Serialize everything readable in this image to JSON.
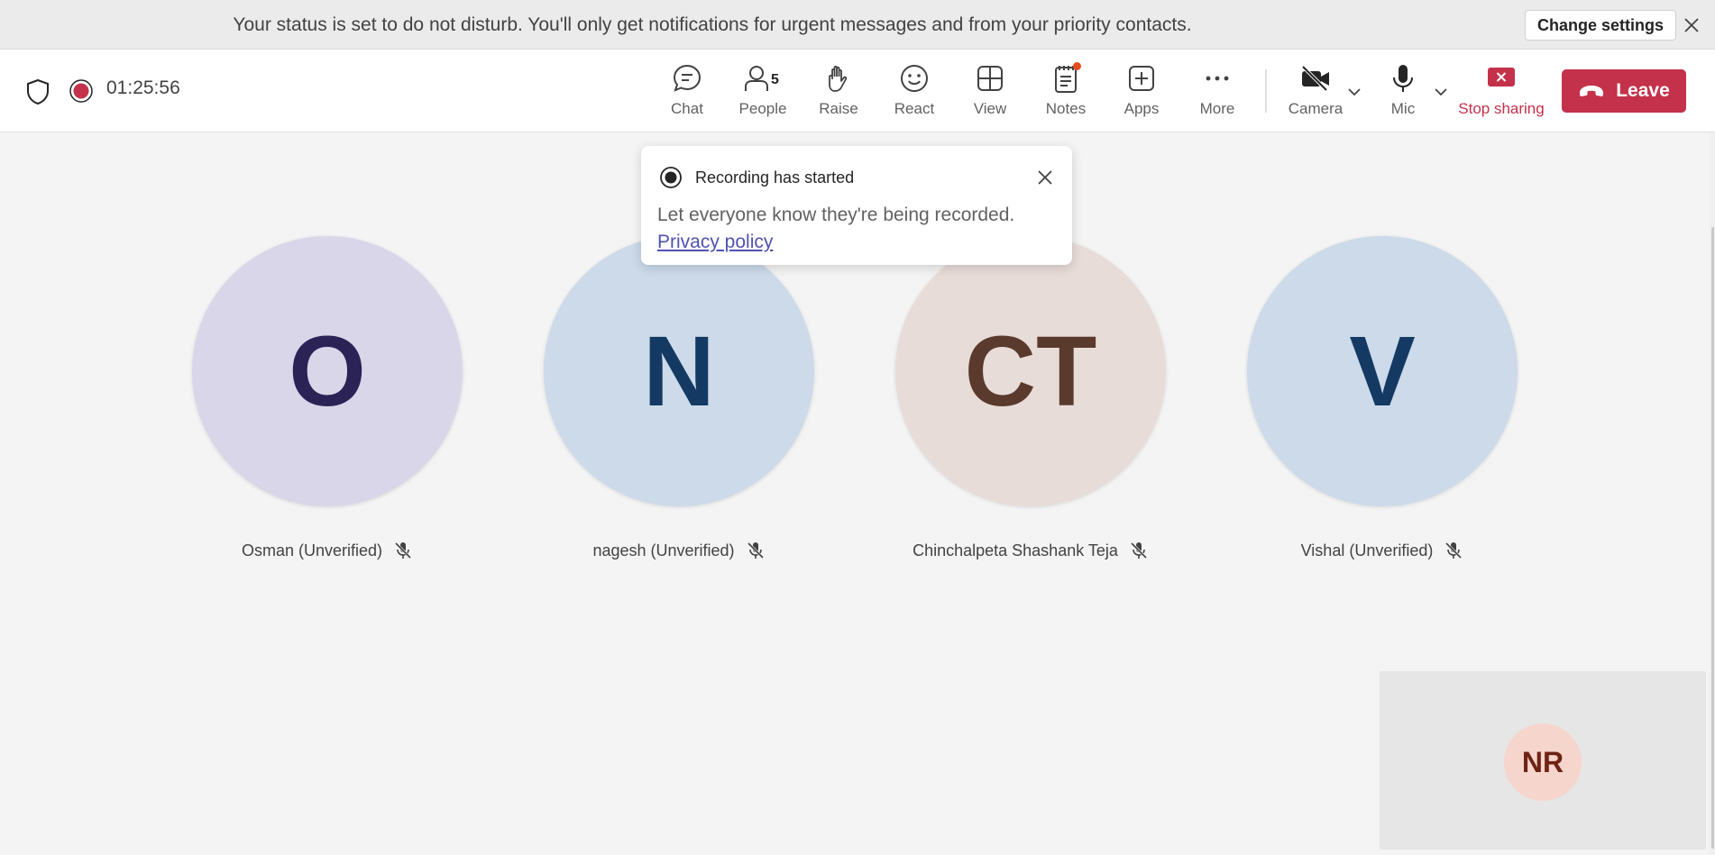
{
  "banner": {
    "text": "Your status is set to do not disturb. You'll only get notifications for urgent messages and from your priority contacts.",
    "button_label": "Change settings",
    "close_icon": "close-icon"
  },
  "toolbar": {
    "timer": "01:25:56",
    "items": {
      "chat": "Chat",
      "people": "People",
      "people_count": "5",
      "raise": "Raise",
      "react": "React",
      "view": "View",
      "notes": "Notes",
      "apps": "Apps",
      "more": "More",
      "camera": "Camera",
      "mic": "Mic",
      "stop_sharing": "Stop sharing"
    },
    "leave_label": "Leave",
    "colors": {
      "leave": "#c4314b",
      "recording": "#c4314b",
      "notes_badge": "#e34c1e"
    }
  },
  "toast": {
    "title": "Recording has started",
    "body": "Let everyone know they're being recorded.",
    "link": "Privacy policy"
  },
  "participants": [
    {
      "initials": "O",
      "name": "Osman (Unverified)",
      "bg": "#d9d6ea",
      "fg": "#2b2356",
      "muted": true
    },
    {
      "initials": "N",
      "name": "nagesh (Unverified)",
      "bg": "#ccdaea",
      "fg": "#143a63",
      "muted": true
    },
    {
      "initials": "CT",
      "name": "Chinchalpeta Shashank Teja",
      "bg": "#e8dcd8",
      "fg": "#5a3a2c",
      "muted": true
    },
    {
      "initials": "V",
      "name": "Vishal (Unverified)",
      "bg": "#ccdaea",
      "fg": "#143a63",
      "muted": true
    }
  ],
  "self_view": {
    "initials": "NR"
  }
}
